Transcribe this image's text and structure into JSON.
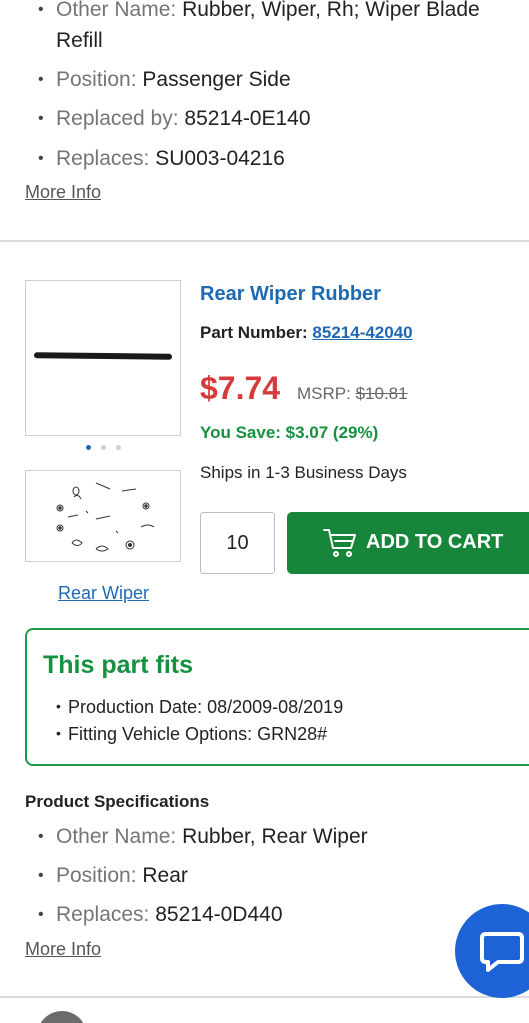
{
  "previous_product": {
    "specs": [
      {
        "key": "Other Name:",
        "value": "Rubber, Wiper, Rh; Wiper Blade",
        "value_line2": "Refill"
      },
      {
        "key": "Position:",
        "value": "Passenger Side"
      },
      {
        "key": "Replaced by:",
        "value": "85214-0E140"
      },
      {
        "key": "Replaces:",
        "value": "SU003-04216"
      }
    ],
    "more_info_label": "More Info"
  },
  "product": {
    "title": "Rear Wiper Rubber",
    "part_number_label": "Part Number:",
    "part_number": "85214-42040",
    "price": "$7.74",
    "msrp_label": "MSRP:",
    "msrp_value": "$10.81",
    "you_save": "You Save: $3.07 (29%)",
    "shipping": "Ships in 1-3 Business Days",
    "quantity": "10",
    "add_to_cart_label": "ADD TO CART",
    "diagram_link_label": "Rear Wiper",
    "image_count": 3,
    "active_image_index": 0
  },
  "fitment": {
    "title": "This part fits",
    "items": [
      "Production Date: 08/2009-08/2019",
      "Fitting Vehicle Options: GRN28#"
    ]
  },
  "specifications": {
    "heading": "Product Specifications",
    "specs": [
      {
        "key": "Other Name:",
        "value": "Rubber, Rear Wiper"
      },
      {
        "key": "Position:",
        "value": "Rear"
      },
      {
        "key": "Replaces:",
        "value": "85214-0D440"
      }
    ],
    "more_info_label": "More Info"
  },
  "chat": {
    "icon": "chat-bubble-icon"
  },
  "colors": {
    "link_blue": "#1f69b3",
    "price_red": "#d63a3a",
    "save_green": "#17903f",
    "cart_green": "#17863a",
    "chat_blue": "#1d63d6"
  }
}
